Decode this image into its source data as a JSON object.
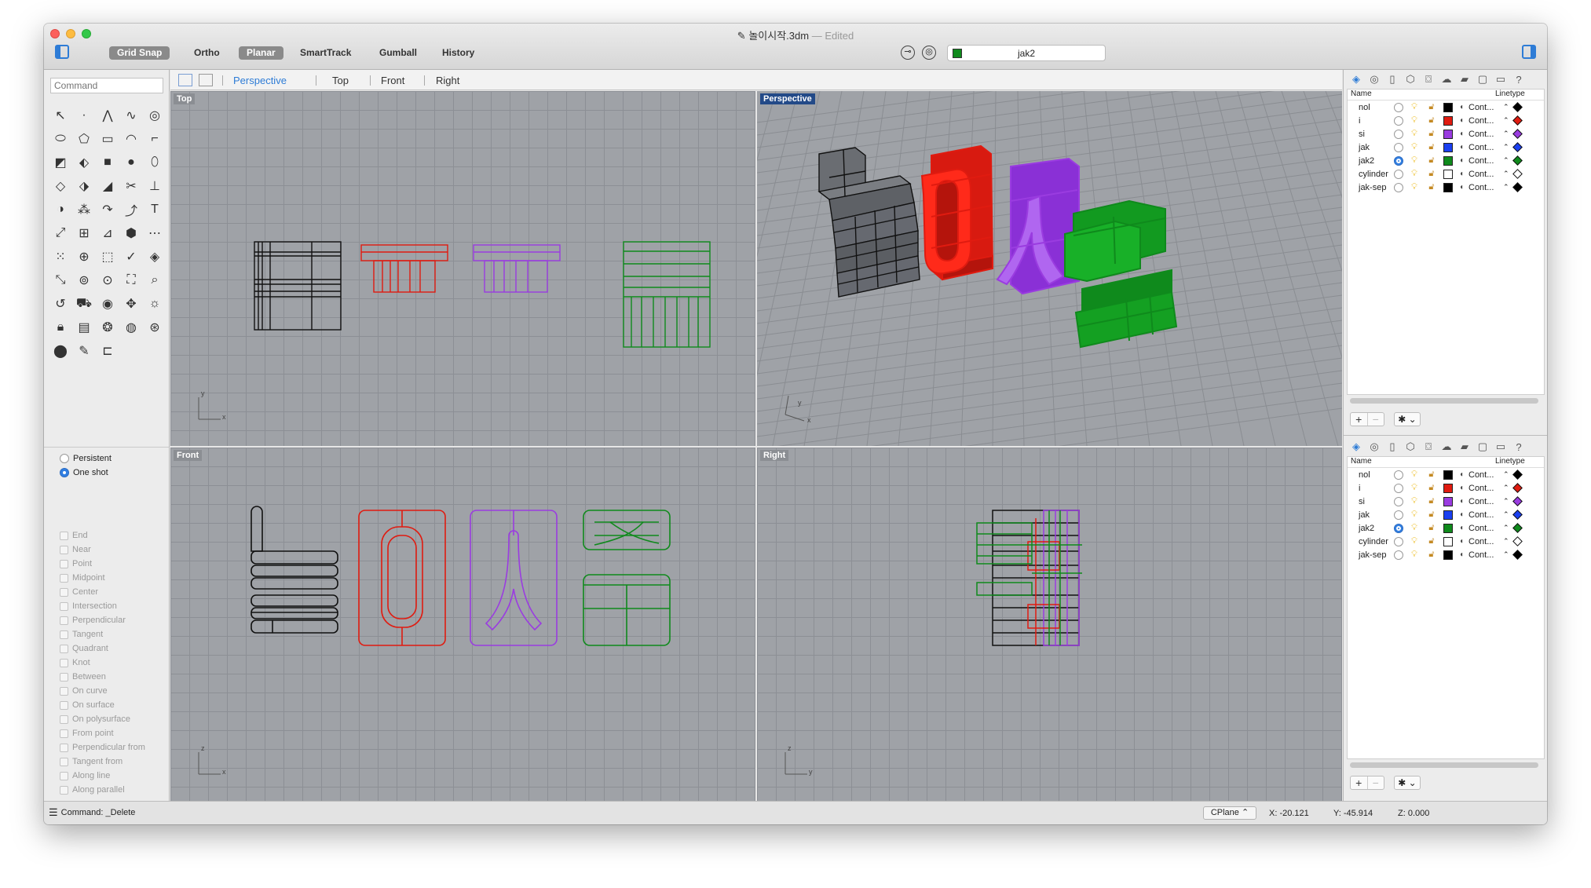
{
  "window": {
    "title": "놀이시작.3dm",
    "title_suffix": "— Edited",
    "doc_icon": "document-icon"
  },
  "toolbar": {
    "buttons": [
      {
        "label": "Grid Snap",
        "on": true
      },
      {
        "label": "Ortho",
        "on": false
      },
      {
        "label": "Planar",
        "on": true
      },
      {
        "label": "SmartTrack",
        "on": false
      },
      {
        "label": "Gumball",
        "on": false
      },
      {
        "label": "History",
        "on": false
      }
    ],
    "current_layer": "jak2",
    "current_layer_color": "#0f8a1c"
  },
  "command": {
    "placeholder": "Command",
    "status": "Command: _Delete"
  },
  "osnap": {
    "modes": [
      {
        "label": "Persistent",
        "selected": false
      },
      {
        "label": "One shot",
        "selected": true
      }
    ],
    "snaps": [
      "End",
      "Near",
      "Point",
      "Midpoint",
      "Center",
      "Intersection",
      "Perpendicular",
      "Tangent",
      "Quadrant",
      "Knot",
      "Between",
      "On curve",
      "On surface",
      "On polysurface",
      "From point",
      "Perpendicular from",
      "Tangent from",
      "Along line",
      "Along parallel"
    ]
  },
  "viewport_tabs": [
    {
      "label": "Perspective",
      "active": true
    },
    {
      "label": "Top",
      "active": false
    },
    {
      "label": "Front",
      "active": false
    },
    {
      "label": "Right",
      "active": false
    }
  ],
  "viewports": {
    "top": {
      "label": "Top",
      "axis_x": "x",
      "axis_y": "y"
    },
    "perspective": {
      "label": "Perspective",
      "axis_x": "x",
      "axis_y": "y"
    },
    "front": {
      "label": "Front",
      "axis_x": "x",
      "axis_y": "z"
    },
    "right": {
      "label": "Right",
      "axis_x": "y",
      "axis_y": "z"
    }
  },
  "layers_panel": {
    "col_name": "Name",
    "col_linetype": "Linetype",
    "layers": [
      {
        "name": "nol",
        "color": "#000000",
        "current": false,
        "linetype": "Cont..."
      },
      {
        "name": "i",
        "color": "#e01b10",
        "current": false,
        "linetype": "Cont..."
      },
      {
        "name": "si",
        "color": "#9a3ce0",
        "current": false,
        "linetype": "Cont..."
      },
      {
        "name": "jak",
        "color": "#1a3ff0",
        "current": false,
        "linetype": "Cont..."
      },
      {
        "name": "jak2",
        "color": "#0f8a1c",
        "current": true,
        "linetype": "Cont..."
      },
      {
        "name": "cylinder",
        "color": "#ffffff",
        "current": false,
        "linetype": "Cont..."
      },
      {
        "name": "jak-sep",
        "color": "#000000",
        "current": false,
        "linetype": "Cont..."
      }
    ],
    "add_label": "+",
    "remove_label": "−",
    "gear_label": "✱ ⌄"
  },
  "status": {
    "cplane": "CPlane",
    "x": "X: -20.121",
    "y": "Y: -45.914",
    "z": "Z: 0.000"
  }
}
